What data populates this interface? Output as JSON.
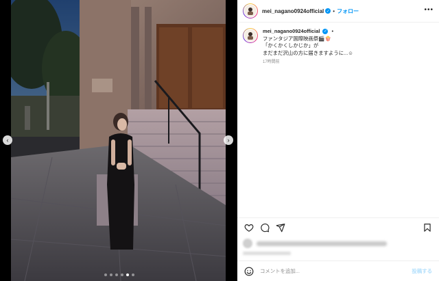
{
  "header": {
    "username": "mei_nagano0924official",
    "separator": "•",
    "follow_label": "フォロー",
    "more_label": "•••"
  },
  "caption": {
    "username": "mei_nagano0924official",
    "dot": "•",
    "lines": [
      "ファンタジア国際映画祭🎬🍿",
      "「かくかくしかじか」が",
      "まだまだ沢山の方に届きますように...☺"
    ],
    "time_ago": "17時間前"
  },
  "comment": {
    "placeholder": "コメントを追加...",
    "post_label": "投稿する"
  },
  "carousel": {
    "prev_label": "‹",
    "next_label": "›",
    "slide_count": 6,
    "active_index": 4
  },
  "colors": {
    "accent": "#0095f6",
    "post_disabled": "#b2dffc",
    "muted": "#8e8e8e"
  },
  "icons": [
    "heart-icon",
    "comment-icon",
    "share-icon",
    "bookmark-icon",
    "emoji-icon",
    "verified-badge-icon",
    "more-options-icon"
  ]
}
